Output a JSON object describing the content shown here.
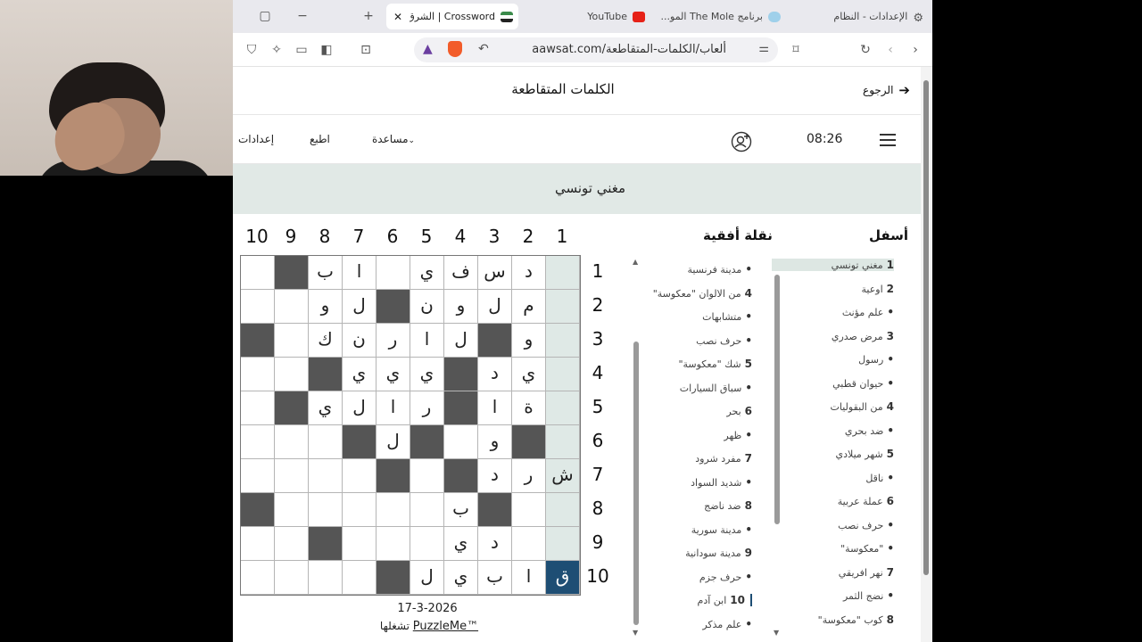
{
  "tabs": [
    {
      "label": "الإعدادات - النظام",
      "icon": "gear-icon"
    },
    {
      "label": "برنامج The Mole المو...",
      "icon": "globe-icon"
    },
    {
      "label": "YouTube",
      "icon": "youtube-icon"
    },
    {
      "label": "Crossword | الشرق الأوسط",
      "icon": "site-icon"
    }
  ],
  "address": {
    "url": "aawsat.com/ألعاب/الكلمات-المتقاطعة"
  },
  "page": {
    "back_label": "الرجوع",
    "title": "الكلمات المتقاطعة",
    "menu": {
      "settings": "إعدادات",
      "print": "اطبع",
      "help": "مساعدة",
      "timer": "08:26"
    },
    "current_clue": "مغني تونسي"
  },
  "grid": {
    "col_numbers": [
      "10",
      "9",
      "8",
      "7",
      "6",
      "5",
      "4",
      "3",
      "2",
      "1"
    ],
    "row_numbers": [
      "1",
      "2",
      "3",
      "4",
      "5",
      "6",
      "7",
      "8",
      "9",
      "10"
    ],
    "rows": [
      [
        "",
        "#",
        "ب",
        "ا",
        "",
        "ي",
        "ف",
        "س",
        "د",
        ""
      ],
      [
        "",
        "",
        "و",
        "ل",
        "#",
        "ن",
        "و",
        "ل",
        "م",
        ""
      ],
      [
        "#",
        "",
        "ك",
        "ن",
        "ر",
        "ا",
        "ل",
        "#",
        "و",
        ""
      ],
      [
        "",
        "",
        "#",
        "ي",
        "ي",
        "ي",
        "#",
        "د",
        "ي",
        ""
      ],
      [
        "",
        "#",
        "ي",
        "ل",
        "ا",
        "ر",
        "#",
        "ا",
        "ة",
        ""
      ],
      [
        "",
        "",
        "",
        "#",
        "ل",
        "#",
        "",
        "و",
        "#",
        ""
      ],
      [
        "",
        "",
        "",
        "",
        "#",
        "",
        "#",
        "د",
        "ر",
        "ش"
      ],
      [
        "#",
        "",
        "",
        "",
        "",
        "",
        "ب",
        "#",
        "",
        ""
      ],
      [
        "",
        "",
        "#",
        "",
        "",
        "",
        "ي",
        "د",
        "",
        ""
      ],
      [
        "",
        "",
        "",
        "",
        "#",
        "ل",
        "ي",
        "ب",
        "ا",
        "ق"
      ]
    ],
    "date": "17-3-2026",
    "credit_prefix": "تشغلها",
    "credit_brand": "PuzzleMe™"
  },
  "across": {
    "heading": "نقلة أفقية",
    "clues": [
      {
        "num": "",
        "text": "مدينة فرنسية"
      },
      {
        "num": "4",
        "text": "من الالوان \"معكوسة\""
      },
      {
        "num": "",
        "text": "متشابهات"
      },
      {
        "num": "",
        "text": "حرف نصب"
      },
      {
        "num": "5",
        "text": "شك \"معكوسة\""
      },
      {
        "num": "",
        "text": "سباق السيارات"
      },
      {
        "num": "6",
        "text": "بحر"
      },
      {
        "num": "",
        "text": "ظهر"
      },
      {
        "num": "7",
        "text": "مفرد شرود"
      },
      {
        "num": "",
        "text": "شديد السواد"
      },
      {
        "num": "8",
        "text": "ضد ناضج"
      },
      {
        "num": "",
        "text": "مدينة سورية"
      },
      {
        "num": "9",
        "text": "مدينة سودانية"
      },
      {
        "num": "",
        "text": "حرف جزم"
      },
      {
        "num": "10",
        "text": "ابن آدم"
      },
      {
        "num": "",
        "text": "علم مذكر"
      }
    ]
  },
  "down": {
    "heading": "أسفل",
    "clues": [
      {
        "num": "1",
        "text": "مغني تونسي"
      },
      {
        "num": "2",
        "text": "اوعية"
      },
      {
        "num": "",
        "text": "علم مؤنث"
      },
      {
        "num": "3",
        "text": "مرض صدري"
      },
      {
        "num": "",
        "text": "رسول"
      },
      {
        "num": "",
        "text": "حيوان قطبي"
      },
      {
        "num": "4",
        "text": "من البقوليات"
      },
      {
        "num": "",
        "text": "ضد بحري"
      },
      {
        "num": "5",
        "text": "شهر ميلادي"
      },
      {
        "num": "",
        "text": "ناقل"
      },
      {
        "num": "6",
        "text": "عملة عربية"
      },
      {
        "num": "",
        "text": "حرف نصب"
      },
      {
        "num": "",
        "text": "\"معكوسة\""
      },
      {
        "num": "7",
        "text": "نهر افريقي"
      },
      {
        "num": "",
        "text": "نضج الثمر"
      },
      {
        "num": "8",
        "text": "كوب \"معكوسة\""
      }
    ]
  }
}
